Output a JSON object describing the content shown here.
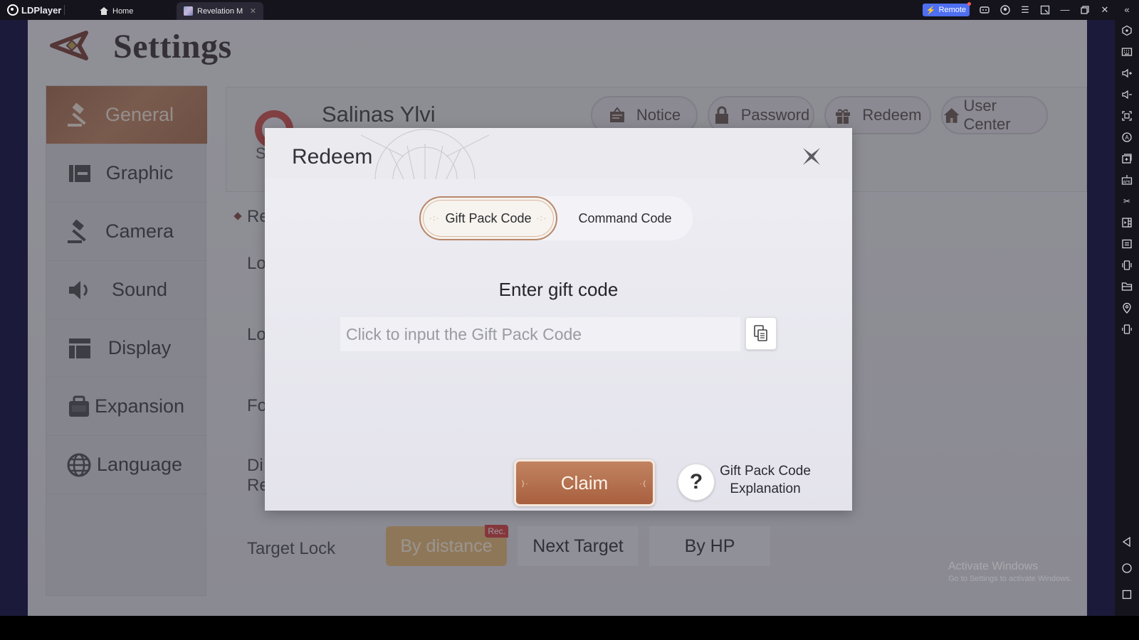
{
  "titlebar": {
    "app_name": "LDPlayer",
    "tabs": [
      {
        "label": "Home",
        "icon": "home-icon",
        "active": false
      },
      {
        "label": "Revelation M",
        "icon": "game-thumbnail",
        "active": true,
        "closable": true
      }
    ],
    "remote_label": "Remote",
    "controls": [
      "gamepad-icon",
      "account-icon",
      "menu-icon",
      "window-mode-icon",
      "minimize-icon",
      "restore-icon",
      "close-icon",
      "collapse-sidebar-icon"
    ]
  },
  "right_toolbar": {
    "icons": [
      "settings-icon",
      "keyboard-icon",
      "volume-up-icon",
      "volume-down-icon",
      "screenshot-icon",
      "auto-rotate-icon",
      "add-window-icon",
      "install-apk-icon",
      "scissors-icon",
      "record-icon",
      "operation-icon",
      "shake-icon",
      "folder-icon",
      "location-icon",
      "rotate-icon"
    ],
    "nav": [
      "back-icon",
      "home-circle-icon",
      "recents-icon"
    ]
  },
  "game": {
    "page_title": "Settings",
    "nav": [
      {
        "label": "General",
        "icon": "gavel-icon",
        "active": true
      },
      {
        "label": "Graphic",
        "icon": "graphic-icon",
        "active": false
      },
      {
        "label": "Camera",
        "icon": "gavel-icon",
        "active": false
      },
      {
        "label": "Sound",
        "icon": "speaker-icon",
        "active": false
      },
      {
        "label": "Display",
        "icon": "layout-icon",
        "active": false
      },
      {
        "label": "Expansion",
        "icon": "bag-icon",
        "active": false
      },
      {
        "label": "Language",
        "icon": "globe-icon",
        "active": false
      }
    ],
    "profile": {
      "name": "Salinas Ylvi",
      "avatar_letter": "S",
      "buttons": [
        {
          "label": "Notice",
          "icon": "notice-icon"
        },
        {
          "label": "Password",
          "icon": "lock-icon"
        },
        {
          "label": "Redeem",
          "icon": "gift-icon"
        },
        {
          "label": "User Center",
          "icon": "house-icon"
        }
      ]
    },
    "rows_partial": [
      "Re",
      "Lo",
      "Lo",
      "Fo",
      "Di",
      "Re"
    ],
    "target_lock": {
      "label": "Target Lock",
      "options": [
        {
          "label": "By distance",
          "selected": true,
          "badge": "Rec."
        },
        {
          "label": "Next Target",
          "selected": false
        },
        {
          "label": "By HP",
          "selected": false
        }
      ]
    }
  },
  "redeem_modal": {
    "title": "Redeem",
    "tabs": [
      {
        "label": "Gift Pack Code",
        "active": true
      },
      {
        "label": "Command Code",
        "active": false
      }
    ],
    "enter_label": "Enter gift code",
    "input_value": "",
    "input_placeholder": "Click to input the Gift Pack Code",
    "claim_label": "Claim",
    "help_symbol": "?",
    "help_label_line1": "Gift Pack Code",
    "help_label_line2": "Explanation"
  },
  "watermark": {
    "line1": "Activate Windows",
    "line2": "Go to Settings to activate Windows."
  },
  "colors": {
    "accent_brown": "#a8603f",
    "remote_blue": "#4e6ff0",
    "selected_gold": "#e3b56a",
    "badge_red": "#d12e2e",
    "avatar_red": "#c8403c"
  }
}
